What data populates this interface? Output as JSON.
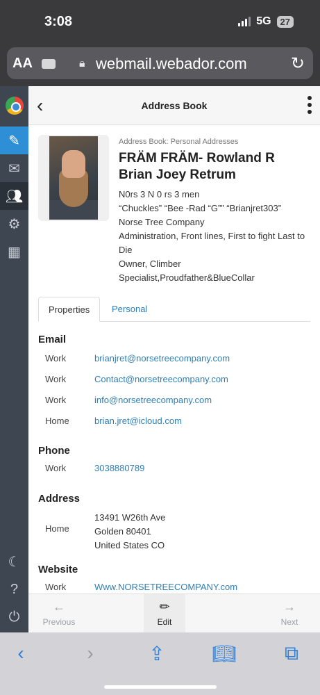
{
  "status": {
    "time": "3:08",
    "network": "5G",
    "battery": "27"
  },
  "browser": {
    "aa": "AA",
    "url": "webmail.webador.com"
  },
  "header": {
    "title": "Address Book"
  },
  "contact": {
    "source": "Address Book: Personal Addresses",
    "name_line1": "FRÄM FRÄM- Rowland R",
    "name_line2": "Brian Joey Retrum",
    "details": [
      "N0rs 3 N 0 rs 3 men",
      "“Chuckles” “Bee -Rad “G”” “Brianjret303”",
      "Norse Tree Company",
      "Administration, Front lines, First to fight Last to",
      "Die",
      "Owner, Climber",
      "Specialist,Proudfather&BlueCollar"
    ]
  },
  "tabs": {
    "properties": "Properties",
    "personal": "Personal"
  },
  "email": {
    "title": "Email",
    "rows": [
      {
        "label": "Work",
        "value": "brianjret@norsetreecompany.com"
      },
      {
        "label": "Work",
        "value": "Contact@norsetreecompany.com"
      },
      {
        "label": "Work",
        "value": "info@norsetreecompany.com"
      },
      {
        "label": "Home",
        "value": "brian.jret@icloud.com"
      }
    ]
  },
  "phone": {
    "title": "Phone",
    "label": "Work",
    "value": "3038880789"
  },
  "address": {
    "title": "Address",
    "label": "Home",
    "line1": "13491 W26th Ave",
    "line2": "Golden 80401",
    "line3": "United States CO"
  },
  "website": {
    "title": "Website",
    "label": "Work",
    "value": "Www.NORSETREECOMPANY.com"
  },
  "toolbar": {
    "previous": "Previous",
    "edit": "Edit",
    "next": "Next"
  },
  "icons": {
    "rail": [
      "app-logo-icon",
      "compose-icon",
      "mail-icon",
      "contacts-icon",
      "settings-icon",
      "apps-grid-icon",
      "dark-mode-icon",
      "help-icon",
      "logout-icon"
    ],
    "accent": "#2f8fd6",
    "link": "#2f7fb5"
  }
}
